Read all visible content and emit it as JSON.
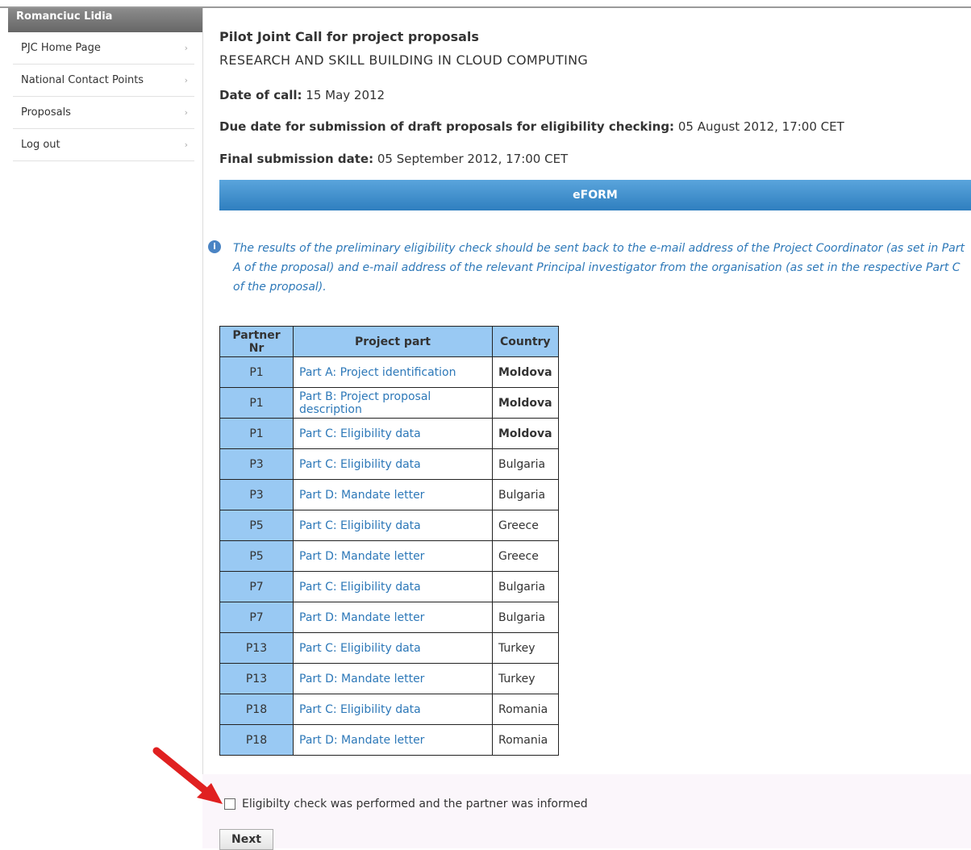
{
  "sidebar": {
    "user_name": "Romanciuc Lidia",
    "items": [
      {
        "label": "PJC Home Page"
      },
      {
        "label": "National Contact Points"
      },
      {
        "label": "Proposals"
      },
      {
        "label": "Log out"
      }
    ],
    "chevron": "›"
  },
  "main": {
    "title": "Pilot Joint Call for project proposals",
    "subtitle": "RESEARCH AND SKILL BUILDING IN CLOUD COMPUTING",
    "date_of_call_label": "Date of call:",
    "date_of_call_value": "15 May 2012",
    "due_date_label": "Due date for submission of draft proposals for eligibility checking:",
    "due_date_value": "05 August 2012, 17:00 CET",
    "final_date_label": "Final submission date:",
    "final_date_value": "05 September 2012, 17:00 CET",
    "eform_label": "eFORM",
    "info_icon": "i",
    "info_text": "The results of the preliminary eligibility check should be sent back to the e-mail address of the Project Coordinator (as set in Part A of the proposal) and e-mail address of the relevant Principal investigator from the organisation (as set in the respective Part C of the proposal)."
  },
  "table": {
    "headers": [
      "Partner Nr",
      "Project part",
      "Country"
    ],
    "rows": [
      {
        "nr": "P1",
        "part": "Part A: Project identification",
        "country": "Moldova"
      },
      {
        "nr": "P1",
        "part": "Part B: Project proposal description",
        "country": "Moldova"
      },
      {
        "nr": "P1",
        "part": "Part C: Eligibility data",
        "country": "Moldova"
      },
      {
        "nr": "P3",
        "part": "Part C: Eligibility data",
        "country": "Bulgaria"
      },
      {
        "nr": "P3",
        "part": "Part D: Mandate letter",
        "country": "Bulgaria"
      },
      {
        "nr": "P5",
        "part": "Part C: Eligibility data",
        "country": "Greece"
      },
      {
        "nr": "P5",
        "part": "Part D: Mandate letter",
        "country": "Greece"
      },
      {
        "nr": "P7",
        "part": "Part C: Eligibility data",
        "country": "Bulgaria"
      },
      {
        "nr": "P7",
        "part": "Part D: Mandate letter",
        "country": "Bulgaria"
      },
      {
        "nr": "P13",
        "part": "Part C: Eligibility data",
        "country": "Turkey"
      },
      {
        "nr": "P13",
        "part": "Part D: Mandate letter",
        "country": "Turkey"
      },
      {
        "nr": "P18",
        "part": "Part C: Eligibility data",
        "country": "Romania"
      },
      {
        "nr": "P18",
        "part": "Part D: Mandate letter",
        "country": "Romania"
      }
    ]
  },
  "form": {
    "checkbox_label": "Eligibilty check was performed and the partner was informed",
    "checkbox_checked": false,
    "next_label": "Next"
  },
  "annotation": {
    "arrow_color": "#e02020",
    "arrow_icon": "red-arrow-icon"
  }
}
